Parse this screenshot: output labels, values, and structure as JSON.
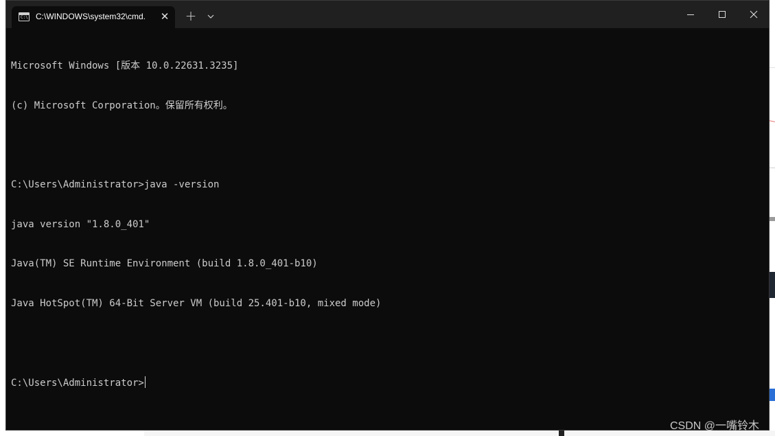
{
  "window": {
    "tab_title": "C:\\WINDOWS\\system32\\cmd.",
    "tab_icon_text": "C:\\",
    "close_tab_glyph": "✕",
    "new_tab_glyph": "+",
    "icons": {
      "tab": "terminal-icon",
      "close_tab": "close-icon",
      "new_tab": "plus-icon",
      "dropdown": "chevron-down-icon",
      "minimize": "minimize-icon",
      "maximize": "maximize-icon",
      "close_window": "close-icon"
    }
  },
  "console": {
    "lines": [
      "Microsoft Windows [版本 10.0.22631.3235]",
      "(c) Microsoft Corporation。保留所有权利。",
      "",
      "C:\\Users\\Administrator>java -version",
      "java version \"1.8.0_401\"",
      "Java(TM) SE Runtime Environment (build 1.8.0_401-b10)",
      "Java HotSpot(TM) 64-Bit Server VM (build 25.401-b10, mixed mode)",
      "",
      "C:\\Users\\Administrator>"
    ]
  },
  "watermark": "CSDN @一嘴铃木",
  "colors": {
    "console_bg": "#0c0c0c",
    "titlebar_bg": "#202020",
    "console_text": "#cccccc"
  }
}
